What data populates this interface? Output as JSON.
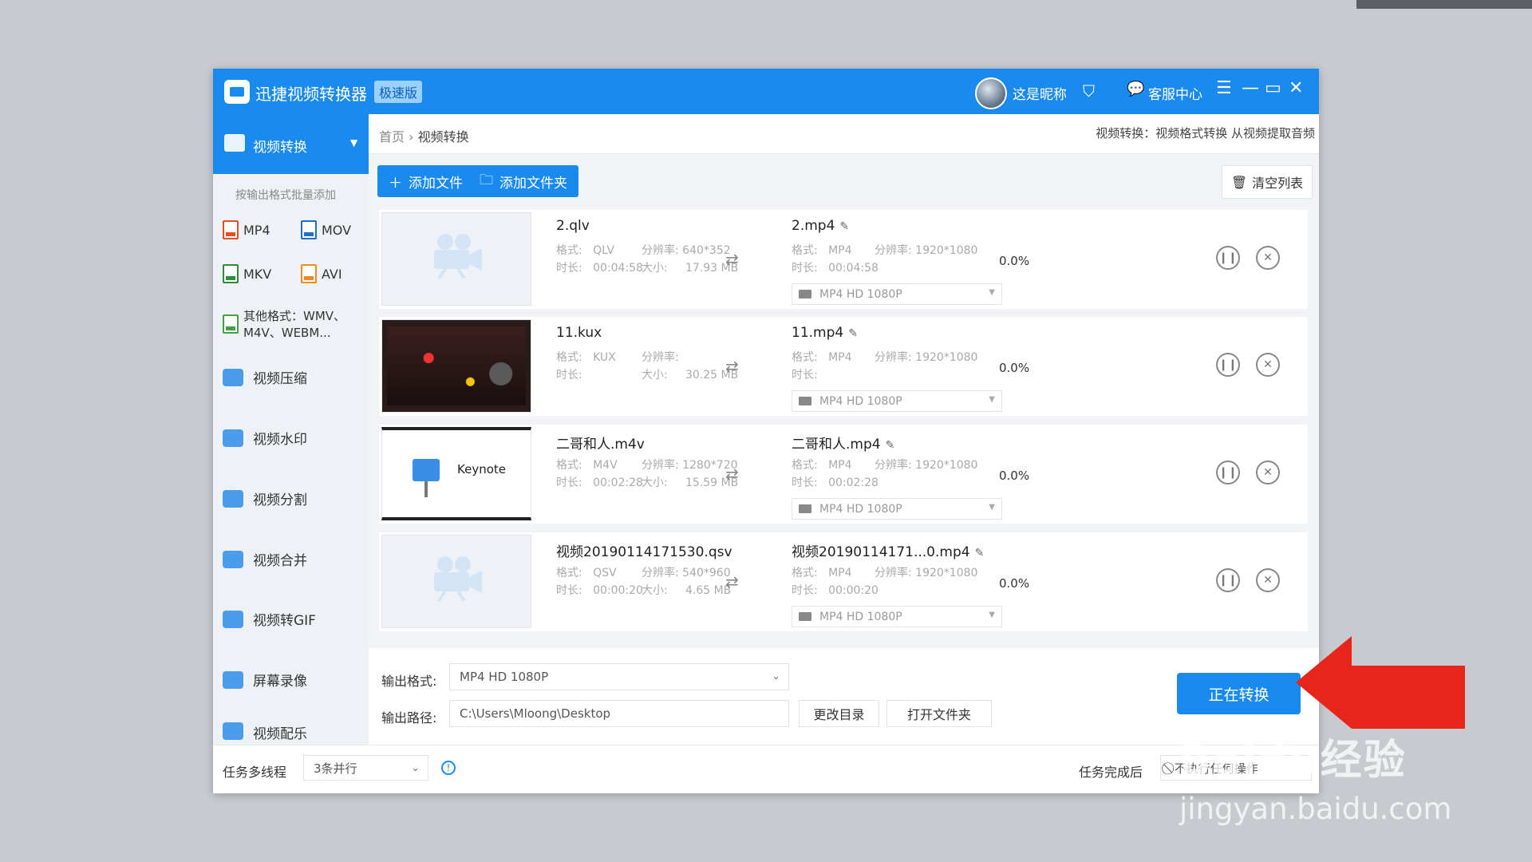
{
  "window": {
    "title": "迅捷视频转换器",
    "badge": "极速版",
    "nickname": "这是昵称",
    "service": "客服中心"
  },
  "sidebar": {
    "active": "视频转换",
    "batch_hint": "按输出格式批量添加",
    "formats": [
      "MP4",
      "MOV",
      "MKV",
      "AVI"
    ],
    "other_formats": "其他格式：WMV、M4V、WEBM...",
    "items": [
      {
        "label": "视频压缩"
      },
      {
        "label": "视频水印"
      },
      {
        "label": "视频分割"
      },
      {
        "label": "视频合并"
      },
      {
        "label": "视频转GIF"
      },
      {
        "label": "屏幕录像"
      },
      {
        "label": "视频配乐"
      }
    ]
  },
  "breadcrumb": {
    "home": "首页",
    "current": "视频转换"
  },
  "header_hint": "视频转换：视频格式转换 从视频提取音频",
  "toolbar": {
    "add_file": "添加文件",
    "add_folder": "添加文件夹",
    "clear": "清空列表"
  },
  "labels": {
    "format": "格式:",
    "duration": "时长:",
    "resolution": "分辨率:",
    "size": "大小:"
  },
  "files": [
    {
      "name": "2.qlv",
      "format": "QLV",
      "resolution": "640*352",
      "duration": "00:04:58",
      "size": "17.93 MB",
      "out_name": "2.mp4",
      "out_format": "MP4",
      "out_resolution": "1920*1080",
      "out_duration": "00:04:58",
      "preset": "MP4  HD 1080P",
      "progress": "0.0%"
    },
    {
      "name": "11.kux",
      "format": "KUX",
      "resolution": "",
      "duration": "",
      "size": "30.25 MB",
      "out_name": "11.mp4",
      "out_format": "MP4",
      "out_resolution": "1920*1080",
      "out_duration": "",
      "preset": "MP4  HD 1080P",
      "progress": "0.0%"
    },
    {
      "name": "二哥和人.m4v",
      "format": "M4V",
      "resolution": "1280*720",
      "duration": "00:02:28",
      "size": "15.59 MB",
      "out_name": "二哥和人.mp4",
      "out_format": "MP4",
      "out_resolution": "1920*1080",
      "out_duration": "00:02:28",
      "preset": "MP4  HD 1080P",
      "progress": "0.0%"
    },
    {
      "name": "视频20190114171530.qsv",
      "format": "QSV",
      "resolution": "540*960",
      "duration": "00:00:20",
      "size": "4.65 MB",
      "out_name": "视频20190114171...0.mp4",
      "out_format": "MP4",
      "out_resolution": "1920*1080",
      "out_duration": "00:00:20",
      "preset": "MP4  HD 1080P",
      "progress": "0.0%"
    }
  ],
  "keynote_label": "Keynote",
  "output": {
    "format_label": "输出格式:",
    "format_value": "MP4  HD 1080P",
    "path_label": "输出路径:",
    "path_value": "C:\\Users\\Mloong\\Desktop",
    "change_dir": "更改目录",
    "open_folder": "打开文件夹",
    "convert": "正在转换"
  },
  "status": {
    "threads_label": "任务多线程",
    "threads_value": "3条并行",
    "after_label": "任务完成后",
    "after_value": "不执行任何操作"
  },
  "watermark": {
    "brand": "Baidu经验",
    "url": "jingyan.baidu.com"
  },
  "colors": {
    "accent": "#1a8aef",
    "arrow": "#e8251b"
  }
}
